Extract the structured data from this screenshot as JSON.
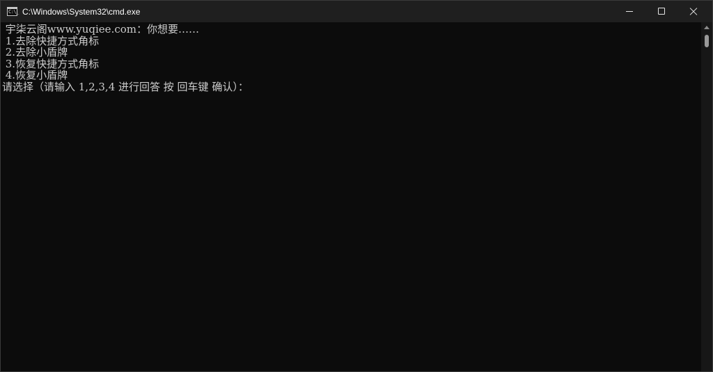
{
  "window": {
    "title": "C:\\Windows\\System32\\cmd.exe",
    "icon": "cmd-icon",
    "icon_glyph": "C:\\_"
  },
  "controls": {
    "minimize": "minimize-icon",
    "maximize": "maximize-icon",
    "close": "close-icon"
  },
  "console": {
    "lines": [
      " 宇柒云阁www.yuqiee.com：你想要……",
      " 1.去除快捷方式角标",
      " 2.去除小盾牌",
      " 3.恢复快捷方式角标",
      " 4.恢复小盾牌",
      "请选择（请输入 1,2,3,4 进行回答 按 回车键 确认）："
    ],
    "text_color": "#cccccc",
    "background": "#0c0c0c"
  }
}
